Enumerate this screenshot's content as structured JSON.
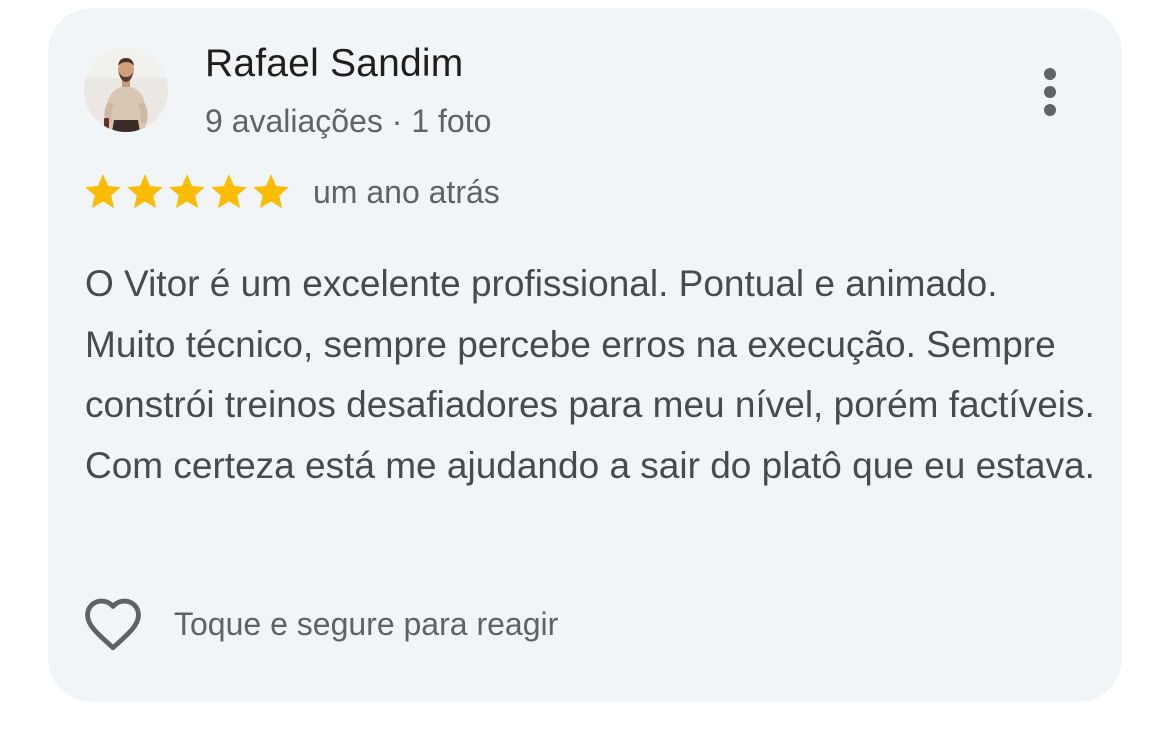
{
  "review": {
    "author": {
      "name": "Rafael Sandim",
      "meta": "9 avaliações · 1 foto",
      "avatar_icon": "person-avatar-photo"
    },
    "rating": {
      "stars": 5,
      "max": 5,
      "star_color": "#fbbc04"
    },
    "date": "um ano atrás",
    "text": "O Vitor é um excelente profissional. Pontual e animado. Muito técnico, sempre percebe erros na execução. Sempre constrói treinos desafiadores para meu nível, porém factíveis. Com certeza está me ajudando a sair do platô que eu estava.",
    "react_label": "Toque e segure para reagir",
    "more_icon": "more-vertical-icon",
    "heart_icon": "heart-outline-icon"
  },
  "colors": {
    "card_background": "#f2f5f7",
    "primary_text": "#1f1f1f",
    "secondary_text": "#5f6368",
    "body_text": "#474a4e"
  }
}
